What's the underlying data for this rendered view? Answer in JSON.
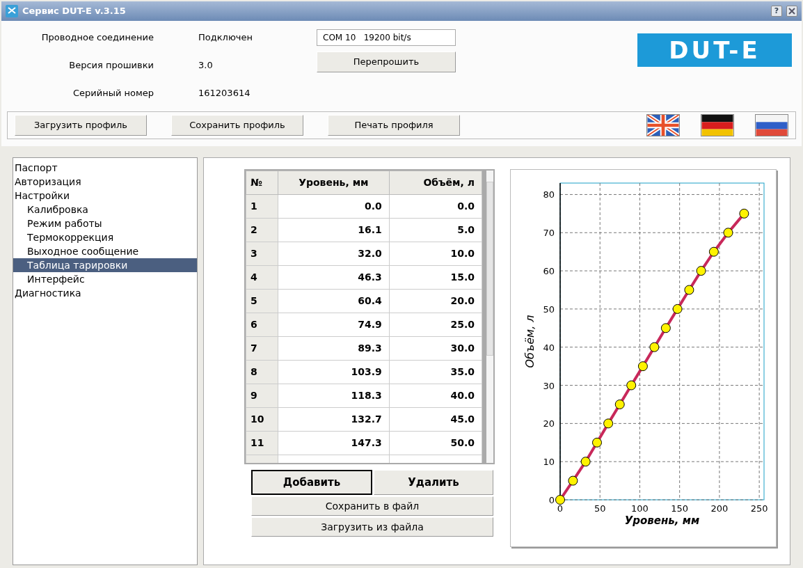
{
  "window": {
    "title": "Сервис DUT-E  v.3.15",
    "help_label": "?"
  },
  "device": {
    "fields": [
      {
        "label": "Проводное соединение",
        "value": "Подключен"
      },
      {
        "label": "Версия прошивки",
        "value": "3.0"
      },
      {
        "label": "Серийный номер",
        "value": "161203614"
      }
    ],
    "port": "COM 10   19200 bit/s",
    "reflash_button": "Перепрошить",
    "logo": "DUT-E"
  },
  "profile_buttons": [
    "Загрузить профиль",
    "Сохранить профиль",
    "Печать профиля"
  ],
  "languages": [
    {
      "kind": "uk"
    },
    {
      "kind": "de"
    },
    {
      "kind": "ru"
    }
  ],
  "sidebar": {
    "items": [
      {
        "label": "Паспорт",
        "selected": false
      },
      {
        "label": "Авторизация",
        "selected": false
      },
      {
        "label": "Настройки",
        "selected": false,
        "children": [
          {
            "label": "Калибровка",
            "selected": false
          },
          {
            "label": "Режим работы",
            "selected": false
          },
          {
            "label": "Термокоррекция",
            "selected": false
          },
          {
            "label": "Выходное сообщение",
            "selected": false
          },
          {
            "label": "Таблица тарировки",
            "selected": true
          },
          {
            "label": "Интерфейс",
            "selected": false
          }
        ]
      },
      {
        "label": "Диагностика",
        "selected": false
      }
    ]
  },
  "table": {
    "columns": [
      "№",
      "Уровень, мм",
      "Объём, л"
    ],
    "rows": [
      [
        "1",
        "0.0",
        "0.0"
      ],
      [
        "2",
        "16.1",
        "5.0"
      ],
      [
        "3",
        "32.0",
        "10.0"
      ],
      [
        "4",
        "46.3",
        "15.0"
      ],
      [
        "5",
        "60.4",
        "20.0"
      ],
      [
        "6",
        "74.9",
        "25.0"
      ],
      [
        "7",
        "89.3",
        "30.0"
      ],
      [
        "8",
        "103.9",
        "35.0"
      ],
      [
        "9",
        "118.3",
        "40.0"
      ],
      [
        "10",
        "132.7",
        "45.0"
      ],
      [
        "11",
        "147.3",
        "50.0"
      ]
    ]
  },
  "table_buttons": {
    "add": "Добавить",
    "delete": "Удалить",
    "save": "Сохранить в файл",
    "load": "Загрузить из файла"
  },
  "chart_data": {
    "type": "line",
    "xlabel": "Уровень, мм",
    "ylabel": "Объём, л",
    "x": [
      0,
      16.1,
      32,
      46.3,
      60.4,
      74.9,
      89.3,
      103.9,
      118.3,
      132.7,
      147.3,
      162,
      177,
      193,
      211,
      231
    ],
    "grid": true,
    "series": [
      {
        "color": "#c8285a",
        "marker": "circle",
        "values": [
          0,
          5,
          10,
          15,
          20,
          25,
          30,
          35,
          40,
          45,
          50,
          55,
          60,
          65,
          70,
          75
        ]
      }
    ],
    "xlim": [
      0,
      256
    ],
    "ylim": [
      0,
      83
    ],
    "xticks": [
      0,
      50,
      100,
      150,
      200,
      250
    ],
    "yticks": [
      0,
      10,
      20,
      30,
      40,
      50,
      60,
      70,
      80
    ]
  }
}
